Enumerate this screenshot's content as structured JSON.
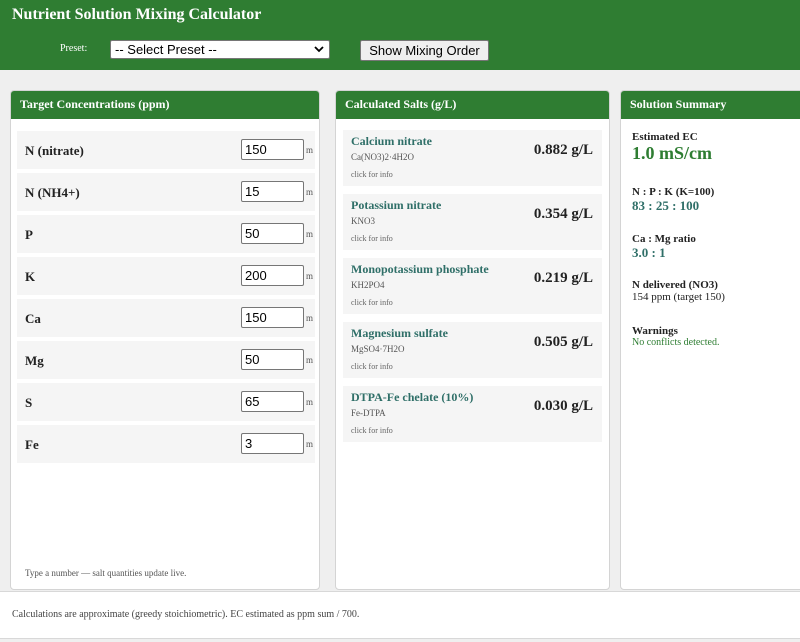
{
  "app": {
    "title": "Nutrient Solution Mixing Calculator"
  },
  "toolbar": {
    "preset_label": "Preset:",
    "preset_value": "-- Select Preset --",
    "order_button": "Show Mixing Order"
  },
  "targets": {
    "title": "Target Concentrations (ppm)",
    "unit": "m",
    "rows": [
      {
        "label": "N (nitrate)",
        "value": "150"
      },
      {
        "label": "N (NH4+)",
        "value": "15"
      },
      {
        "label": "P",
        "value": "50"
      },
      {
        "label": "K",
        "value": "200"
      },
      {
        "label": "Ca",
        "value": "150"
      },
      {
        "label": "Mg",
        "value": "50"
      },
      {
        "label": "S",
        "value": "65"
      },
      {
        "label": "Fe",
        "value": "3"
      }
    ],
    "hint": "Type a number — salt quantities update live."
  },
  "salts": {
    "title": "Calculated Salts (g/L)",
    "info": "click for info",
    "items": [
      {
        "name": "Calcium nitrate",
        "formula": "Ca(NO3)2·4H2O",
        "qty": "0.882 g/L"
      },
      {
        "name": "Potassium nitrate",
        "formula": "KNO3",
        "qty": "0.354 g/L"
      },
      {
        "name": "Monopotassium phosphate",
        "formula": "KH2PO4",
        "qty": "0.219 g/L"
      },
      {
        "name": "Magnesium sulfate",
        "formula": "MgSO4·7H2O",
        "qty": "0.505 g/L"
      },
      {
        "name": "DTPA-Fe chelate (10%)",
        "formula": "Fe-DTPA",
        "qty": "0.030 g/L"
      }
    ]
  },
  "summary": {
    "title": "Solution Summary",
    "ec_label": "Estimated EC",
    "ec_value": "1.0 mS/cm",
    "npk_label": "N : P : K (K=100)",
    "npk_value": "83 : 25 : 100",
    "camg_label": "Ca : Mg ratio",
    "camg_value": "3.0 : 1",
    "ndel_label": "N delivered (NO3)",
    "ndel_value": "154 ppm (target 150)",
    "warn_label": "Warnings",
    "warn_value": "No conflicts detected."
  },
  "footer": {
    "text": "Calculations are approximate (greedy stoichiometric). EC estimated as ppm sum / 700."
  },
  "colors": {
    "header_green": "#2f7d32",
    "accent_teal": "#2f6f68",
    "ec_green": "#2e7d32"
  }
}
